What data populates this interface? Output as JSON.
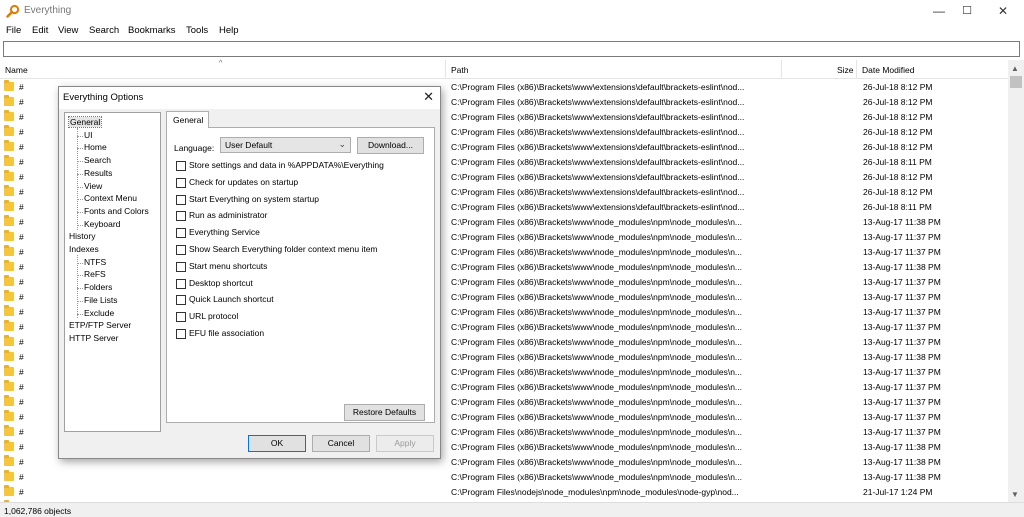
{
  "window": {
    "title": "Everything",
    "minimize": "—",
    "maximize": "☐",
    "close": "✕"
  },
  "menu": [
    "File",
    "Edit",
    "View",
    "Search",
    "Bookmarks",
    "Tools",
    "Help"
  ],
  "search": {
    "value": ""
  },
  "columns": {
    "name": "Name",
    "path": "Path",
    "size": "Size",
    "date": "Date Modified"
  },
  "rows": [
    {
      "name": "#",
      "path": "C:\\Program Files (x86)\\Brackets\\www\\extensions\\default\\brackets-eslint\\nod...",
      "date": "26-Jul-18 8:12 PM"
    },
    {
      "name": "#",
      "path": "C:\\Program Files (x86)\\Brackets\\www\\extensions\\default\\brackets-eslint\\nod...",
      "date": "26-Jul-18 8:12 PM"
    },
    {
      "name": "#",
      "path": "C:\\Program Files (x86)\\Brackets\\www\\extensions\\default\\brackets-eslint\\nod...",
      "date": "26-Jul-18 8:12 PM"
    },
    {
      "name": "#",
      "path": "C:\\Program Files (x86)\\Brackets\\www\\extensions\\default\\brackets-eslint\\nod...",
      "date": "26-Jul-18 8:12 PM"
    },
    {
      "name": "#",
      "path": "C:\\Program Files (x86)\\Brackets\\www\\extensions\\default\\brackets-eslint\\nod...",
      "date": "26-Jul-18 8:12 PM"
    },
    {
      "name": "#",
      "path": "C:\\Program Files (x86)\\Brackets\\www\\extensions\\default\\brackets-eslint\\nod...",
      "date": "26-Jul-18 8:11 PM"
    },
    {
      "name": "#",
      "path": "C:\\Program Files (x86)\\Brackets\\www\\extensions\\default\\brackets-eslint\\nod...",
      "date": "26-Jul-18 8:12 PM"
    },
    {
      "name": "#",
      "path": "C:\\Program Files (x86)\\Brackets\\www\\extensions\\default\\brackets-eslint\\nod...",
      "date": "26-Jul-18 8:12 PM"
    },
    {
      "name": "#",
      "path": "C:\\Program Files (x86)\\Brackets\\www\\extensions\\default\\brackets-eslint\\nod...",
      "date": "26-Jul-18 8:11 PM"
    },
    {
      "name": "#",
      "path": "C:\\Program Files (x86)\\Brackets\\www\\node_modules\\npm\\node_modules\\n...",
      "date": "13-Aug-17 11:38 PM"
    },
    {
      "name": "#",
      "path": "C:\\Program Files (x86)\\Brackets\\www\\node_modules\\npm\\node_modules\\n...",
      "date": "13-Aug-17 11:37 PM"
    },
    {
      "name": "#",
      "path": "C:\\Program Files (x86)\\Brackets\\www\\node_modules\\npm\\node_modules\\n...",
      "date": "13-Aug-17 11:37 PM"
    },
    {
      "name": "#",
      "path": "C:\\Program Files (x86)\\Brackets\\www\\node_modules\\npm\\node_modules\\n...",
      "date": "13-Aug-17 11:38 PM"
    },
    {
      "name": "#",
      "path": "C:\\Program Files (x86)\\Brackets\\www\\node_modules\\npm\\node_modules\\n...",
      "date": "13-Aug-17 11:37 PM"
    },
    {
      "name": "#",
      "path": "C:\\Program Files (x86)\\Brackets\\www\\node_modules\\npm\\node_modules\\n...",
      "date": "13-Aug-17 11:37 PM"
    },
    {
      "name": "#",
      "path": "C:\\Program Files (x86)\\Brackets\\www\\node_modules\\npm\\node_modules\\n...",
      "date": "13-Aug-17 11:37 PM"
    },
    {
      "name": "#",
      "path": "C:\\Program Files (x86)\\Brackets\\www\\node_modules\\npm\\node_modules\\n...",
      "date": "13-Aug-17 11:37 PM"
    },
    {
      "name": "#",
      "path": "C:\\Program Files (x86)\\Brackets\\www\\node_modules\\npm\\node_modules\\n...",
      "date": "13-Aug-17 11:37 PM"
    },
    {
      "name": "#",
      "path": "C:\\Program Files (x86)\\Brackets\\www\\node_modules\\npm\\node_modules\\n...",
      "date": "13-Aug-17 11:38 PM"
    },
    {
      "name": "#",
      "path": "C:\\Program Files (x86)\\Brackets\\www\\node_modules\\npm\\node_modules\\n...",
      "date": "13-Aug-17 11:37 PM"
    },
    {
      "name": "#",
      "path": "C:\\Program Files (x86)\\Brackets\\www\\node_modules\\npm\\node_modules\\n...",
      "date": "13-Aug-17 11:37 PM"
    },
    {
      "name": "#",
      "path": "C:\\Program Files (x86)\\Brackets\\www\\node_modules\\npm\\node_modules\\n...",
      "date": "13-Aug-17 11:37 PM"
    },
    {
      "name": "#",
      "path": "C:\\Program Files (x86)\\Brackets\\www\\node_modules\\npm\\node_modules\\n...",
      "date": "13-Aug-17 11:37 PM"
    },
    {
      "name": "#",
      "path": "C:\\Program Files (x86)\\Brackets\\www\\node_modules\\npm\\node_modules\\n...",
      "date": "13-Aug-17 11:37 PM"
    },
    {
      "name": "#",
      "path": "C:\\Program Files (x86)\\Brackets\\www\\node_modules\\npm\\node_modules\\n...",
      "date": "13-Aug-17 11:38 PM"
    },
    {
      "name": "#",
      "path": "C:\\Program Files (x86)\\Brackets\\www\\node_modules\\npm\\node_modules\\n...",
      "date": "13-Aug-17 11:38 PM"
    },
    {
      "name": "#",
      "path": "C:\\Program Files (x86)\\Brackets\\www\\node_modules\\npm\\node_modules\\n...",
      "date": "13-Aug-17 11:38 PM"
    },
    {
      "name": "#",
      "path": "C:\\Program Files\\nodejs\\node_modules\\npm\\node_modules\\node-gyp\\nod...",
      "date": "21-Jul-17 1:24 PM"
    },
    {
      "name": "#",
      "path": "C:\\Program Files\\nodejs\\node_modules\\npm\\node_modules\\node-gyp\\nod...",
      "date": "21-Jul-17 1:24 PM"
    },
    {
      "name": "#",
      "path": "C:\\Program Files\\nodejs\\node_modules\\npm\\node_modules\\node-gyp\\nod...",
      "date": "21-Jul-17 1:24 PM"
    }
  ],
  "status": "1,062,786 objects",
  "dialog": {
    "title": "Everything Options",
    "close": "✕",
    "tree": [
      {
        "label": "General",
        "level": 0,
        "selected": true
      },
      {
        "label": "UI",
        "level": 1
      },
      {
        "label": "Home",
        "level": 1
      },
      {
        "label": "Search",
        "level": 1
      },
      {
        "label": "Results",
        "level": 1
      },
      {
        "label": "View",
        "level": 1
      },
      {
        "label": "Context Menu",
        "level": 1
      },
      {
        "label": "Fonts and Colors",
        "level": 1
      },
      {
        "label": "Keyboard",
        "level": 1
      },
      {
        "label": "History",
        "level": 0
      },
      {
        "label": "Indexes",
        "level": 0
      },
      {
        "label": "NTFS",
        "level": 1
      },
      {
        "label": "ReFS",
        "level": 1
      },
      {
        "label": "Folders",
        "level": 1
      },
      {
        "label": "File Lists",
        "level": 1
      },
      {
        "label": "Exclude",
        "level": 1
      },
      {
        "label": "ETP/FTP Server",
        "level": 0
      },
      {
        "label": "HTTP Server",
        "level": 0
      }
    ],
    "tab": "General",
    "language_label": "Language:",
    "language_value": "User Default",
    "download": "Download...",
    "options": [
      {
        "label": "Store settings and data in %APPDATA%\\Everything",
        "checked": false
      },
      {
        "label": "Check for updates on startup",
        "checked": false
      },
      {
        "label": "Start Everything on system startup",
        "checked": false
      },
      {
        "label": "Run as administrator",
        "checked": false
      },
      {
        "label": "Everything Service",
        "checked": false
      },
      {
        "label": "Show Search Everything folder context menu item",
        "checked": false
      },
      {
        "label": "Start menu shortcuts",
        "checked": false
      },
      {
        "label": "Desktop shortcut",
        "checked": false
      },
      {
        "label": "Quick Launch shortcut",
        "checked": false
      },
      {
        "label": "URL protocol",
        "checked": false
      },
      {
        "label": "EFU file association",
        "checked": false
      }
    ],
    "restore": "Restore Defaults",
    "ok": "OK",
    "cancel": "Cancel",
    "apply": "Apply"
  },
  "colors": {
    "folder": "#f5c53b",
    "accent": "#0078d7",
    "dialog_bg": "#f0f0f0"
  }
}
